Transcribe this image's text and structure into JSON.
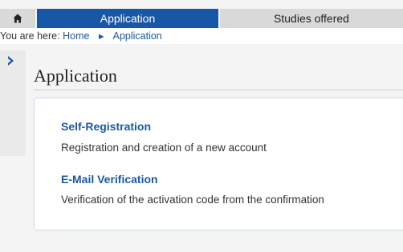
{
  "nav": {
    "home_icon": "home-icon",
    "tabs": [
      {
        "label": "Application",
        "active": true
      },
      {
        "label": "Studies offered",
        "active": false
      }
    ]
  },
  "breadcrumb": {
    "lead": "You are here:",
    "items": [
      "Home",
      "Application"
    ],
    "separator_icon": "chevron-right-icon"
  },
  "sidebar": {
    "toggle_icon": "chevron-right-icon"
  },
  "page": {
    "title": "Application"
  },
  "entries": [
    {
      "title": "Self-Registration",
      "description": "Registration and creation of a new account"
    },
    {
      "title": "E-Mail Verification",
      "description": "Verification of the activation code from the confirmation"
    }
  ],
  "colors": {
    "accent": "#1856a8",
    "link": "#1a58a8",
    "tab_inactive": "#d9d9d9",
    "background": "#f4f4f4"
  }
}
